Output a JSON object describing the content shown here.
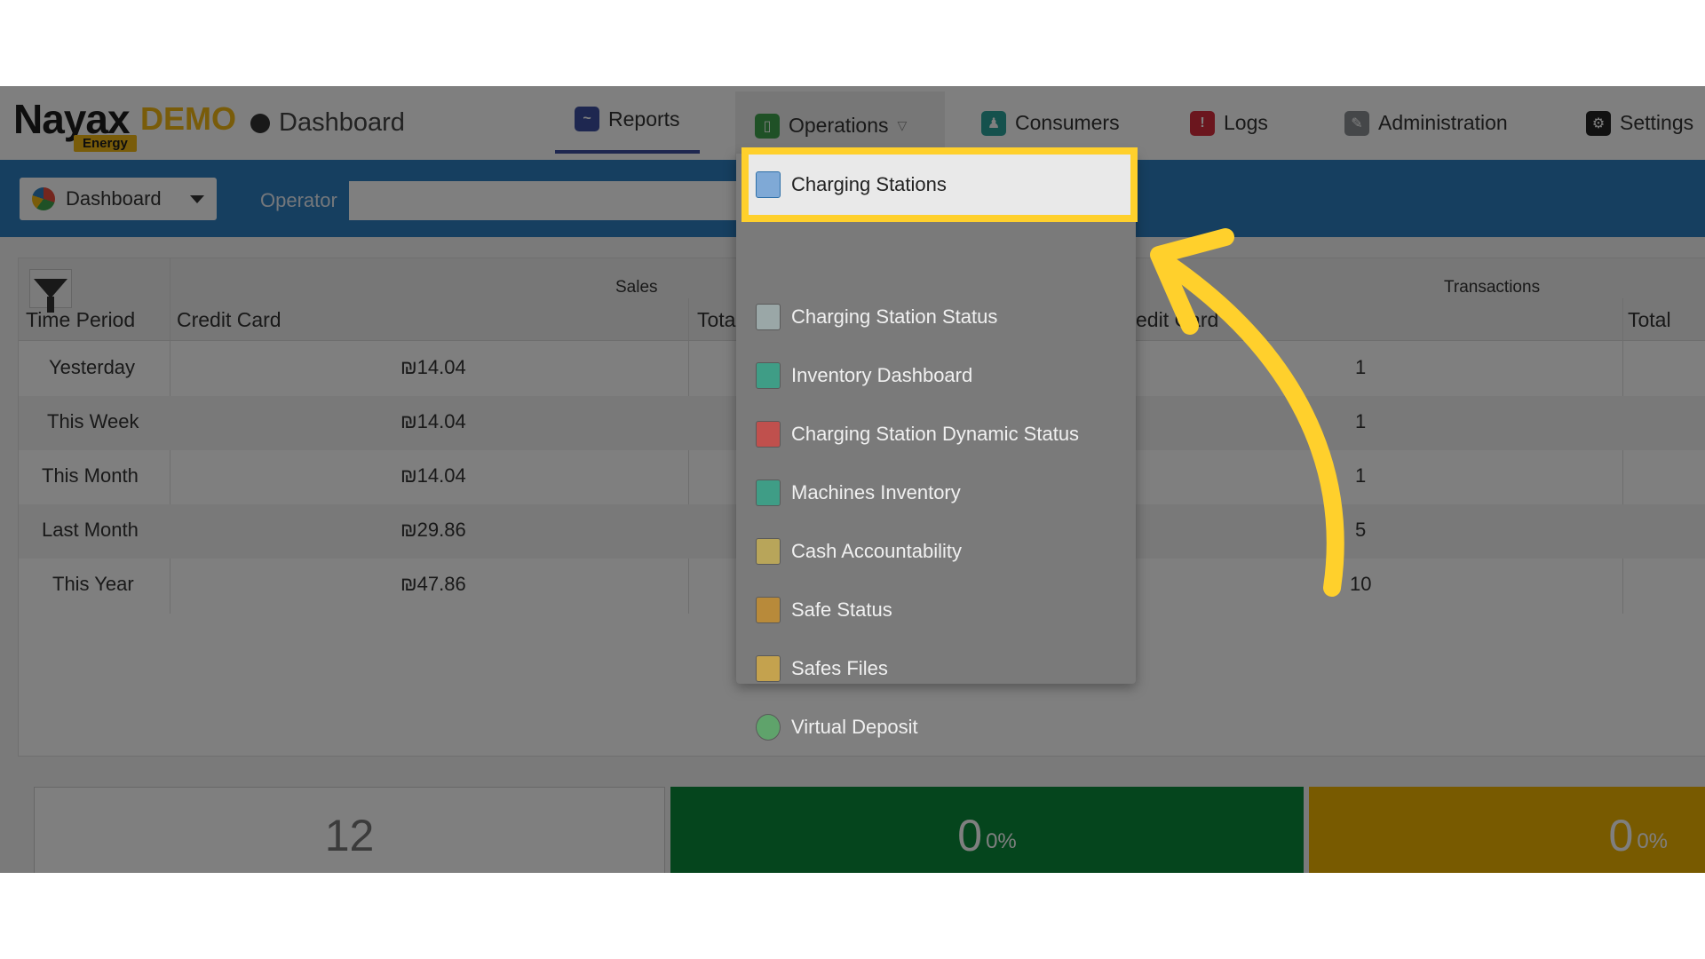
{
  "header": {
    "logo_main": "Nayax",
    "logo_demo": "DEMO",
    "logo_sub": "Energy",
    "page_title": "Dashboard",
    "nav": {
      "reports": "Reports",
      "operations": "Operations",
      "consumers": "Consumers",
      "logs": "Logs",
      "administration": "Administration",
      "settings": "Settings"
    }
  },
  "toolbar": {
    "dashboard_select": "Dashboard",
    "operator_label": "Operator",
    "operator_value": ""
  },
  "table": {
    "group_sales": "Sales",
    "group_transactions": "Transactions",
    "col_time_period": "Time Period",
    "col_credit_card": "Credit Card",
    "col_total_partial": "Tota",
    "col_credit_card_partial": "edit Card",
    "col_total": "Total",
    "rows": [
      {
        "period": "Yesterday",
        "sales_cc": "₪14.04",
        "tx_cc": "1"
      },
      {
        "period": "This Week",
        "sales_cc": "₪14.04",
        "tx_cc": "1"
      },
      {
        "period": "This Month",
        "sales_cc": "₪14.04",
        "tx_cc": "1"
      },
      {
        "period": "Last Month",
        "sales_cc": "₪29.86",
        "tx_cc": "5"
      },
      {
        "period": "This Year",
        "sales_cc": "₪47.86",
        "tx_cc": "10"
      }
    ]
  },
  "tiles": {
    "total": "12",
    "green_value": "0",
    "green_pct": "0%",
    "yellow_value": "0",
    "yellow_pct": "0%"
  },
  "menu": {
    "items": [
      "Charging Stations",
      "Charging Station Status",
      "Inventory Dashboard",
      "Charging Station Dynamic Status",
      "Machines Inventory",
      "Cash Accountability",
      "Safe Status",
      "Safes Files",
      "Virtual Deposit"
    ]
  },
  "colors": {
    "toolbar_blue": "#2d7fc1",
    "highlight_yellow": "#ffd02c",
    "tile_green": "#0a8a3a",
    "tile_yellow": "#f0b400"
  }
}
